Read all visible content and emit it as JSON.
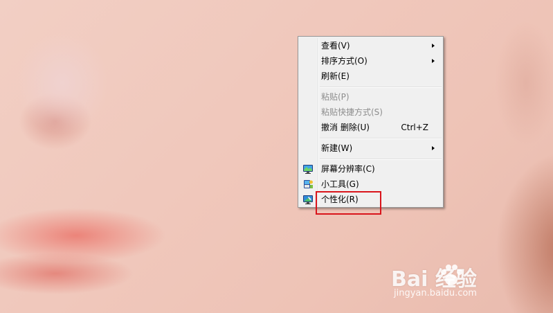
{
  "context_menu": {
    "items": [
      {
        "label": "查看(V)",
        "has_submenu": true,
        "enabled": true
      },
      {
        "label": "排序方式(O)",
        "has_submenu": true,
        "enabled": true
      },
      {
        "label": "刷新(E)",
        "enabled": true
      },
      {
        "label": "粘贴(P)",
        "enabled": false
      },
      {
        "label": "粘贴快捷方式(S)",
        "enabled": false
      },
      {
        "label": "撤消 删除(U)",
        "shortcut": "Ctrl+Z",
        "enabled": true
      },
      {
        "label": "新建(W)",
        "has_submenu": true,
        "enabled": true
      },
      {
        "label": "屏幕分辨率(C)",
        "icon": "display-icon",
        "enabled": true
      },
      {
        "label": "小工具(G)",
        "icon": "gadgets-icon",
        "enabled": true
      },
      {
        "label": "个性化(R)",
        "icon": "personalize-icon",
        "enabled": true,
        "highlighted": true
      }
    ]
  },
  "annotation": {
    "target": "个性化(R)",
    "color": "#d9141b"
  },
  "watermark": {
    "logo_text": "Bai  经验",
    "url": "jingyan.baidu.com"
  }
}
